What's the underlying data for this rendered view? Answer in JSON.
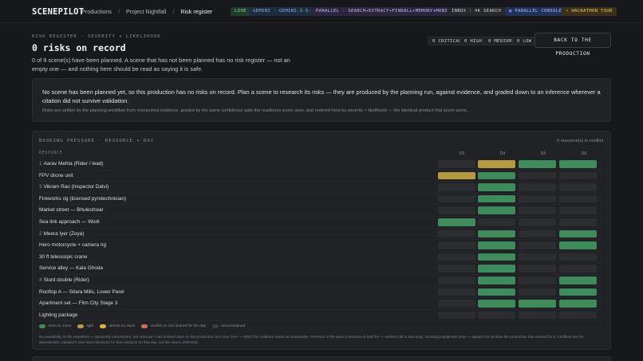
{
  "topbar": {
    "logo": "SCENEPILOT",
    "crumbs": [
      "Productions",
      "Project Nightfall",
      "Risk register"
    ],
    "live": "LIVE",
    "model": "GEMINI · GEMINI-3.5-FLASH",
    "parallel": "PARALLEL · SEARCH+EXTRACT+FINDALL+MEMORY+MONITOR+TASK",
    "inbox": "INBOX",
    "search": "⌘K SEARCH",
    "console": "PARALLEL CONSOLE",
    "tour": "HACKATHON TOUR"
  },
  "header": {
    "eyebrow": "RISK REGISTER · SEVERITY × LIKELIHOOD",
    "title": "0 risks on record",
    "subtitle": "0 of 9 scene(s) have been planned. A scene that has not been planned has no risk register — not an empty one — and nothing here should be read as saying it is safe.",
    "severity": [
      "0 CRITICAL",
      "0 HIGH",
      "0 MEDIUM",
      "0 LOW"
    ],
    "back_label": "BACK TO THE PRODUCTION"
  },
  "info": {
    "main": "No scene has been planned yet, so this production has no risks on record. Plan a scene to research its risks — they are produced by the planning run, against evidence, and graded down to an inference wherever a citation did not survive validation.",
    "sub": "Risks are written by the planning workflow from researched evidence, graded by the same confidence gate the readiness score uses, and ordered here by severity × likelihood — the identical product that score sums."
  },
  "booking": {
    "title": "BOOKING PRESSURE · RESOURCE × DAY",
    "count": "0 resource(s) in conflict",
    "resource_head": "RESOURCE",
    "days": [
      "D3",
      "D4",
      "D5",
      "D6"
    ],
    "rows": [
      {
        "idx": "1",
        "label": "Aarav Mehta (Rider / lead)",
        "cells": [
          "none",
          "tight",
          "room",
          "room"
        ]
      },
      {
        "idx": "",
        "label": "FPV drone unit",
        "cells": [
          "tight",
          "room",
          "none",
          "none"
        ]
      },
      {
        "idx": "3",
        "label": "Vikram Rao (Inspector Dalvi)",
        "cells": [
          "none",
          "room",
          "none",
          "none"
        ]
      },
      {
        "idx": "",
        "label": "Fireworks rig (licensed pyrotechnician)",
        "cells": [
          "none",
          "room",
          "none",
          "none"
        ]
      },
      {
        "idx": "",
        "label": "Market street — Bhuleshwar",
        "cells": [
          "none",
          "room",
          "none",
          "none"
        ]
      },
      {
        "idx": "",
        "label": "Sea link approach — Worli",
        "cells": [
          "room",
          "none",
          "none",
          "none"
        ]
      },
      {
        "idx": "2",
        "label": "Meera Iyer (Zoya)",
        "cells": [
          "none",
          "room",
          "none",
          "room"
        ]
      },
      {
        "idx": "",
        "label": "Hero motorcycle + camera rig",
        "cells": [
          "none",
          "room",
          "none",
          "room"
        ]
      },
      {
        "idx": "",
        "label": "30 ft telescopic crane",
        "cells": [
          "none",
          "room",
          "none",
          "none"
        ]
      },
      {
        "idx": "",
        "label": "Service alley — Kala Ghoda",
        "cells": [
          "none",
          "room",
          "none",
          "none"
        ]
      },
      {
        "idx": "4",
        "label": "Stunt double (Rider)",
        "cells": [
          "none",
          "room",
          "none",
          "room"
        ]
      },
      {
        "idx": "",
        "label": "Rooftop A — Sitara Mills, Lower Parel",
        "cells": [
          "none",
          "room",
          "none",
          "room"
        ]
      },
      {
        "idx": "",
        "label": "Apartment set — Film City Stage 3",
        "cells": [
          "none",
          "room",
          "room",
          "room"
        ]
      },
      {
        "idx": "",
        "label": "Lighting package",
        "cells": [
          "none",
          "none",
          "none",
          "none"
        ]
      }
    ],
    "legend": [
      {
        "label": "room to move",
        "color": "#3e8c5c"
      },
      {
        "label": "tight",
        "color": "#b59a3f"
      },
      {
        "label": "almost no slack",
        "color": "#e0b23c"
      },
      {
        "label": "conflict or not cleared for the day",
        "color": "#d56a5b"
      },
      {
        "label": "unconstrained",
        "color": "#3a3c41"
      }
    ],
    "note": "No availability on file anywhere — genuinely unrestricted, not unknown. Has booked days on this production but none here — which the validator reads as unavailable. Pressure is the span a resource is held for — earliest call to last wrap, including equipment prep — against the window the production has cleared for it. Conflicts are the deterministic validator's own hard rejections for that resource on that day, not this view's arithmetic."
  },
  "colors": {
    "room": "#3e8c5c",
    "tight": "#b59a3f",
    "none": "#2b2d31"
  }
}
